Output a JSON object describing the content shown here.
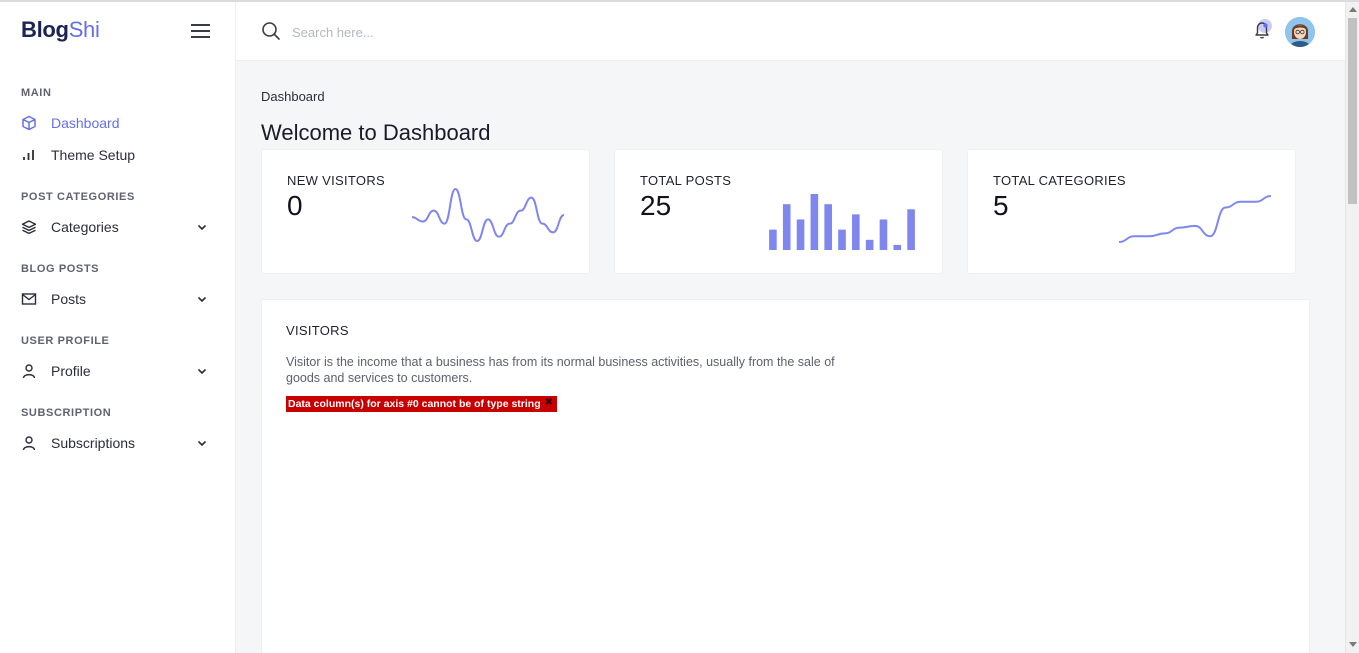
{
  "brand": {
    "part1": "Blog",
    "part2": "Shi"
  },
  "sidebar": {
    "sections": [
      {
        "label": "MAIN"
      },
      {
        "label": "POST CATEGORIES"
      },
      {
        "label": "BLOG POSTS"
      },
      {
        "label": "USER PROFILE"
      },
      {
        "label": "SUBSCRIPTION"
      }
    ],
    "items": [
      {
        "label": "Dashboard",
        "icon": "cube-icon",
        "active": true
      },
      {
        "label": "Theme Setup",
        "icon": "bar-chart-icon"
      },
      {
        "label": "Categories",
        "icon": "layers-icon",
        "expandable": true
      },
      {
        "label": "Posts",
        "icon": "mail-icon",
        "expandable": true
      },
      {
        "label": "Profile",
        "icon": "user-icon",
        "expandable": true
      },
      {
        "label": "Subscriptions",
        "icon": "user-icon",
        "expandable": true
      }
    ]
  },
  "header": {
    "search_placeholder": "Search here...",
    "icons": [
      "search-icon",
      "bell-icon",
      "avatar"
    ]
  },
  "main": {
    "breadcrumb": "Dashboard",
    "title": "Welcome to Dashboard",
    "cards": [
      {
        "label": "NEW VISITORS",
        "value": "0",
        "sparkline": "line"
      },
      {
        "label": "TOTAL POSTS",
        "value": "25",
        "sparkline": "bar"
      },
      {
        "label": "TOTAL CATEGORIES",
        "value": "5",
        "sparkline": "line"
      }
    ],
    "visitors": {
      "title": "VISITORS",
      "description": "Visitor is the income that a business has from its normal business activities, usually from the sale of goods and services to customers.",
      "error": "Data column(s) for axis #0 cannot be of type string",
      "error_close": "✖"
    }
  },
  "colors": {
    "accent": "#6570e6",
    "sparkline": "#7f87ee",
    "error_bg": "#c80000",
    "brand_dark": "#1c2454"
  },
  "chart_data": [
    {
      "type": "line",
      "series": [
        {
          "values": [
            5,
            3,
            8,
            2,
            18,
            4,
            -6,
            4,
            -4,
            2,
            8,
            14,
            2,
            -2,
            6
          ]
        }
      ]
    },
    {
      "type": "bar",
      "series": [
        {
          "values": [
            4,
            9,
            6,
            11,
            9,
            4,
            7,
            2,
            6,
            1,
            8
          ]
        }
      ]
    },
    {
      "type": "line",
      "series": [
        {
          "values": [
            1,
            2,
            2,
            2.5,
            3.5,
            3.8,
            2,
            7,
            8,
            8,
            9
          ]
        }
      ]
    }
  ]
}
